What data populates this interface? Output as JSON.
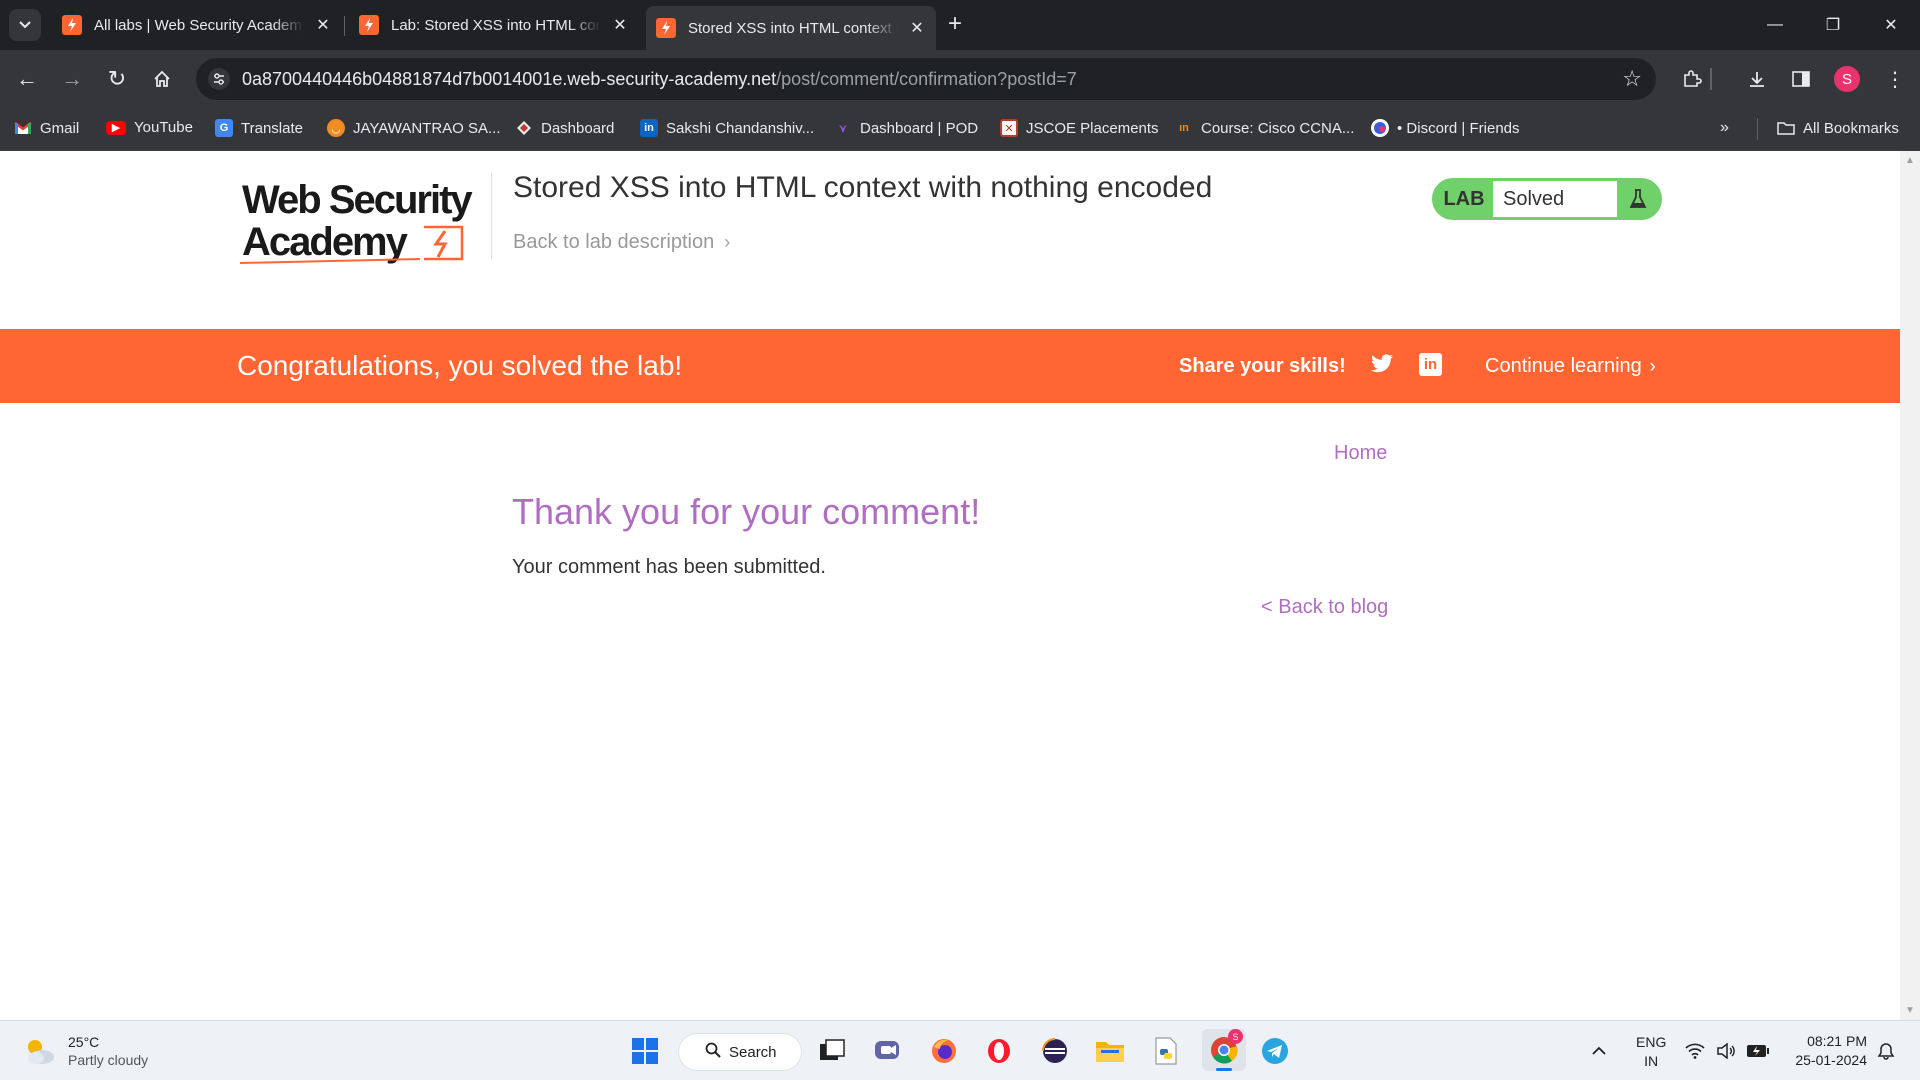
{
  "browser": {
    "tabs": [
      {
        "title": "All labs | Web Security Academy",
        "active": false
      },
      {
        "title": "Lab: Stored XSS into HTML context with nothing encoded",
        "active": false
      },
      {
        "title": "Stored XSS into HTML context with nothing encoded",
        "active": true
      }
    ],
    "url_host": "0a8700440446b04881874d7b0014001e.web-security-academy.net",
    "url_path": "/post/comment/confirmation?postId=7",
    "profile_initial": "S",
    "bookmarks": [
      {
        "label": "Gmail",
        "icon": "gmail-icon"
      },
      {
        "label": "YouTube",
        "icon": "youtube-icon"
      },
      {
        "label": "Translate",
        "icon": "translate-icon"
      },
      {
        "label": "JAYAWANTRAO SA...",
        "icon": "college-icon"
      },
      {
        "label": "Dashboard",
        "icon": "dashboard-icon"
      },
      {
        "label": "Sakshi Chandanshiv...",
        "icon": "linkedin-icon"
      },
      {
        "label": "Dashboard | POD",
        "icon": "pod-icon"
      },
      {
        "label": "JSCOE Placements",
        "icon": "placements-icon"
      },
      {
        "label": "Course: Cisco CCNA...",
        "icon": "cisco-icon"
      },
      {
        "label": "• Discord | Friends",
        "icon": "discord-icon"
      }
    ],
    "all_bookmarks_label": "All Bookmarks"
  },
  "page": {
    "lab_title": "Stored XSS into HTML context with nothing encoded",
    "back_to_description": "Back to lab description",
    "lab_badge": {
      "label": "LAB",
      "status": "Solved"
    },
    "banner": {
      "message": "Congratulations, you solved the lab!",
      "share": "Share your skills!",
      "continue": "Continue learning"
    },
    "home_link": "Home",
    "heading": "Thank you for your comment!",
    "body": "Your comment has been submitted.",
    "back_to_blog": "< Back to blog"
  },
  "taskbar": {
    "weather": {
      "temp": "25°C",
      "condition": "Partly cloudy"
    },
    "search_label": "Search",
    "language": {
      "line1": "ENG",
      "line2": "IN"
    },
    "time": "08:21 PM",
    "date": "25-01-2024"
  },
  "colors": {
    "accent_orange": "#ff6633",
    "link_purple": "#b06ec2",
    "solved_green": "#70d16a",
    "chrome_dark": "#202124",
    "chrome_toolbar": "#35363a"
  }
}
